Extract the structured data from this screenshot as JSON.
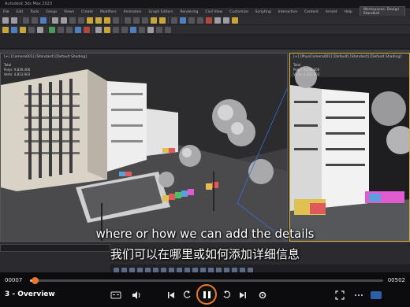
{
  "app": {
    "title": "Autodesk 3ds Max 2023",
    "menu": [
      "File",
      "Edit",
      "Tools",
      "Group",
      "Views",
      "Create",
      "Modifiers",
      "Animation",
      "Graph Editors",
      "Rendering",
      "Civil View",
      "Customize",
      "Scripting",
      "Interactive",
      "Content",
      "Arnold",
      "Help"
    ],
    "workspace": "Workspaces: Design Standard"
  },
  "viewports": {
    "main_label": "[+] [Camera001] [Standard] [Default Shading]",
    "main_stats": "Total\nPolys: 9,839,406\nVerts: 4,812,903",
    "side_label": "[+] [PhysCamera001] [Default] [Standard] [Default Shading]",
    "side_stats": "Total\nPolys: 9,839,406\nVerts: 4,812,903"
  },
  "subtitles": {
    "english": "where or how we can add the details",
    "chinese": "我们可以在哪里或如何添加详细信息"
  },
  "player": {
    "current_time": "00007",
    "total_time": "00502",
    "progress": 0.014,
    "episode_title": "3 - Overview",
    "accent_color": "#e87830",
    "icons": [
      "captions-icon",
      "volume-icon",
      "previous-icon",
      "rewind-icon",
      "play-pause-icon",
      "forward-icon",
      "next-icon",
      "settings-icon",
      "fullscreen-icon"
    ]
  }
}
